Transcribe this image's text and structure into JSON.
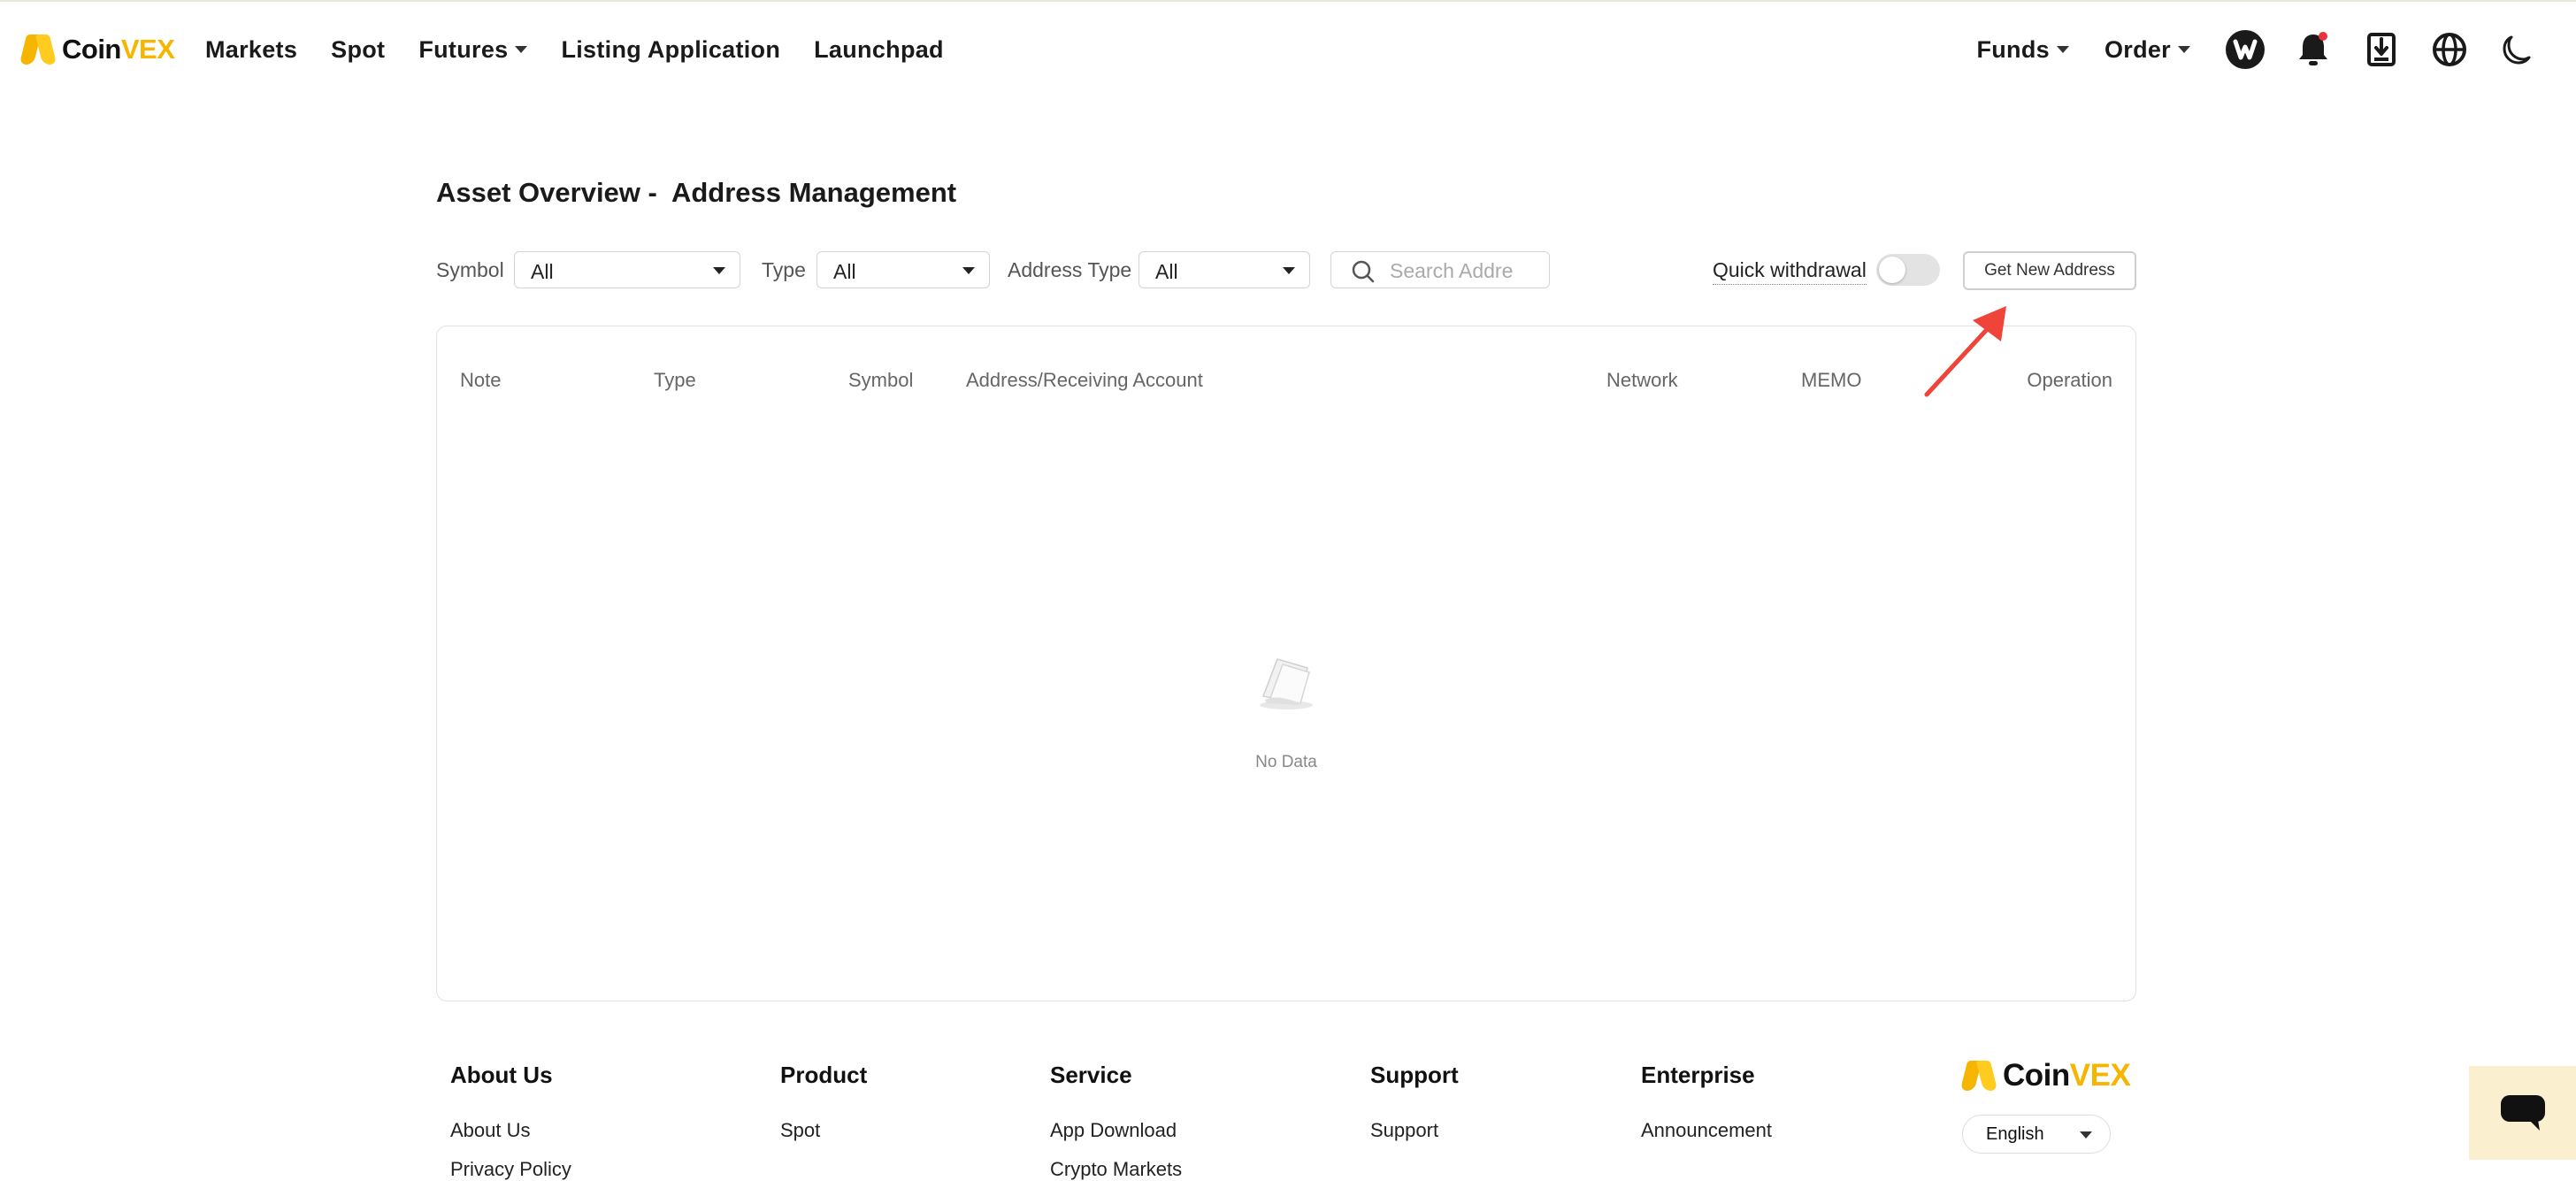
{
  "brand": {
    "name_part1": "Coin",
    "name_part2": "VEX",
    "accent": "#f5b500"
  },
  "nav": {
    "links": [
      {
        "label": "Markets"
      },
      {
        "label": "Spot"
      },
      {
        "label": "Futures"
      },
      {
        "label": "Listing Application"
      },
      {
        "label": "Launchpad"
      }
    ],
    "right": {
      "funds": "Funds",
      "order": "Order",
      "icons": [
        "user-avatar-icon",
        "bell-icon",
        "download-icon",
        "globe-icon",
        "moon-icon"
      ]
    }
  },
  "page": {
    "title_prefix": "Asset Overview -",
    "title_main": "Address Management"
  },
  "filters": {
    "symbol_label": "Symbol",
    "symbol_value": "All",
    "type_label": "Type",
    "type_value": "All",
    "address_type_label": "Address Type",
    "address_type_value": "All",
    "search_placeholder": "Search Addre",
    "quick_withdrawal_label": "Quick withdrawal",
    "quick_withdrawal_on": false,
    "get_new_address": "Get New Address"
  },
  "table": {
    "columns": [
      "Note",
      "Type",
      "Symbol",
      "Address/Receiving Account",
      "Network",
      "MEMO",
      "Operation"
    ],
    "rows": [],
    "empty_text": "No Data"
  },
  "footer": {
    "columns": [
      {
        "heading": "About Us",
        "links": [
          "About Us",
          "Privacy Policy"
        ]
      },
      {
        "heading": "Product",
        "links": [
          "Spot"
        ]
      },
      {
        "heading": "Service",
        "links": [
          "App Download",
          "Crypto Markets"
        ]
      },
      {
        "heading": "Support",
        "links": [
          "Support"
        ]
      },
      {
        "heading": "Enterprise",
        "links": [
          "Announcement"
        ]
      }
    ],
    "language": "English"
  }
}
